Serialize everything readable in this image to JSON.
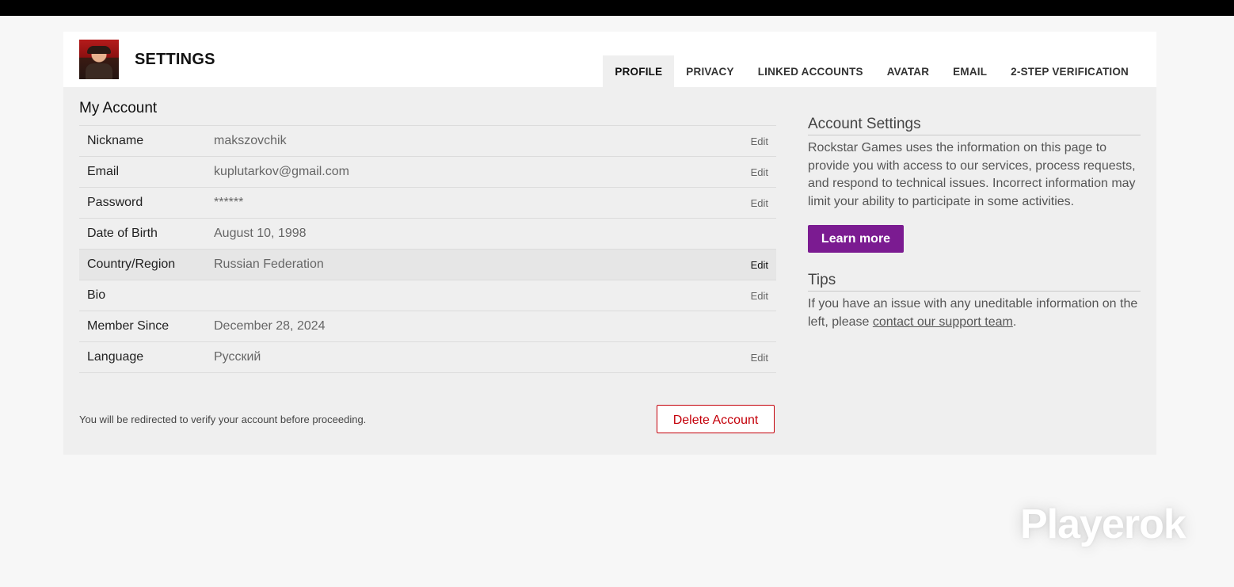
{
  "header": {
    "title": "SETTINGS",
    "tabs": [
      {
        "label": "PROFILE",
        "active": true
      },
      {
        "label": "PRIVACY"
      },
      {
        "label": "LINKED ACCOUNTS"
      },
      {
        "label": "AVATAR"
      },
      {
        "label": "EMAIL"
      },
      {
        "label": "2-STEP VERIFICATION"
      }
    ]
  },
  "account": {
    "title": "My Account",
    "edit_label": "Edit",
    "rows": [
      {
        "label": "Nickname",
        "value": "makszovchik",
        "editable": true
      },
      {
        "label": "Email",
        "value": "kuplutarkov@gmail.com",
        "editable": true
      },
      {
        "label": "Password",
        "value": "******",
        "editable": true
      },
      {
        "label": "Date of Birth",
        "value": "August 10, 1998",
        "editable": false
      },
      {
        "label": "Country/Region",
        "value": "Russian Federation",
        "editable": true,
        "highlight": true
      },
      {
        "label": "Bio",
        "value": "",
        "editable": true
      },
      {
        "label": "Member Since",
        "value": "December 28, 2024",
        "editable": false
      },
      {
        "label": "Language",
        "value": "Русский",
        "editable": true
      }
    ],
    "note": "You will be redirected to verify your account before proceeding.",
    "delete_label": "Delete Account"
  },
  "sidebar": {
    "settings_title": "Account Settings",
    "settings_text": "Rockstar Games uses the information on this page to provide you with access to our services, process requests, and respond to technical issues. Incorrect information may limit your ability to participate in some activities.",
    "learn_more": "Learn more",
    "tips_title": "Tips",
    "tips_text_before": "If you have an issue with any uneditable information on the left, please ",
    "tips_link": "contact our support team",
    "tips_text_after": "."
  },
  "watermark": "Playerok",
  "colors": {
    "accent": "#7b1b91",
    "danger": "#c4000a",
    "panel": "#efefef",
    "page": "#f7f7f7"
  }
}
